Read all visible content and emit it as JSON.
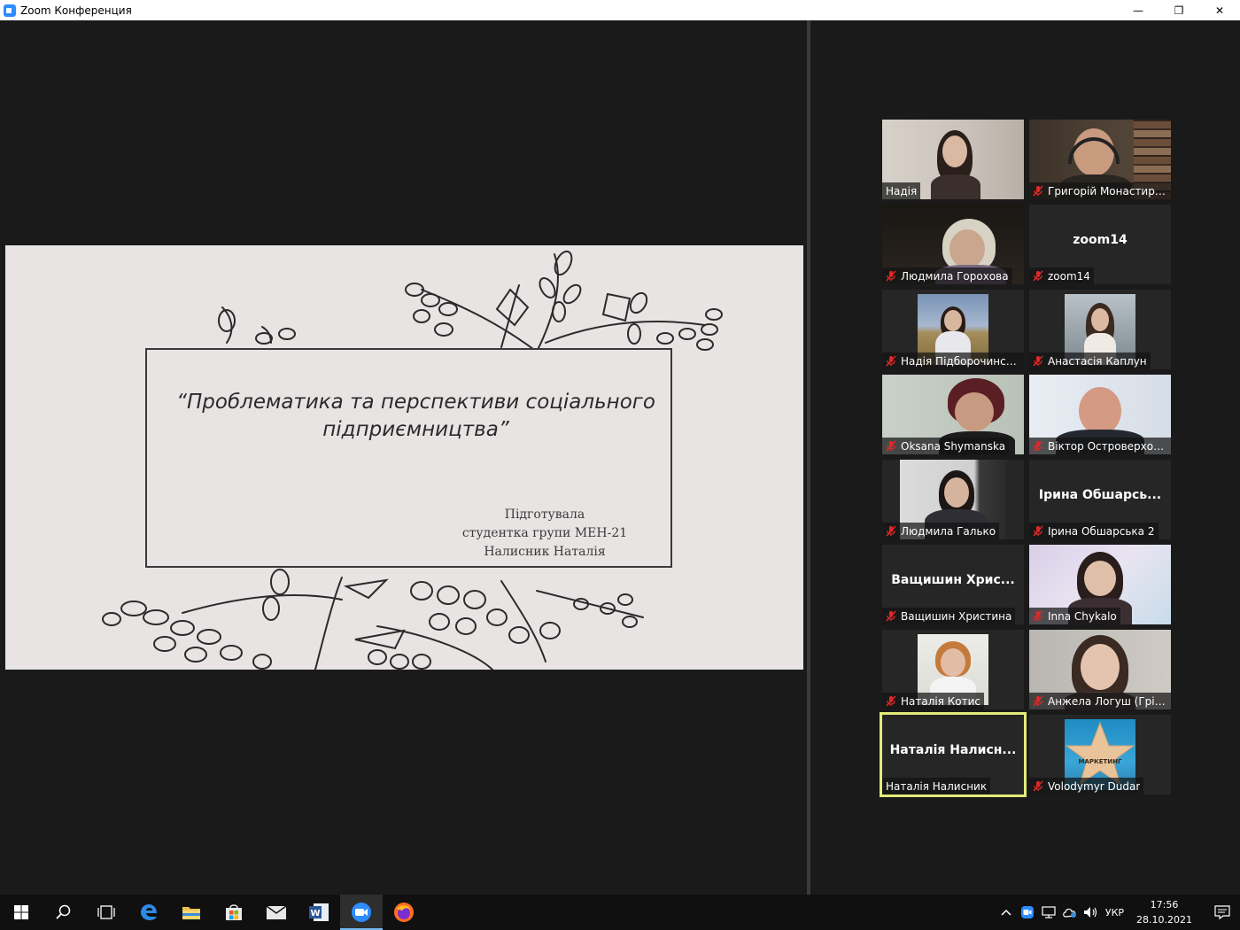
{
  "window": {
    "title": "Zoom Конференция",
    "minimize_label": "—",
    "maximize_label": "❐",
    "close_label": "✕"
  },
  "slide": {
    "title": "“Проблематика та перспективи соціального підприємництва”",
    "author_lines": [
      "Підготувала",
      "студентка групи МЕН-21",
      "Налисник Наталія"
    ]
  },
  "participants": [
    {
      "name": "Надія",
      "muted": false,
      "video": true
    },
    {
      "name": "Григорій Монастирс...",
      "muted": true,
      "video": true
    },
    {
      "name": "Людмила Горохова",
      "muted": true,
      "video": true
    },
    {
      "name": "zoom14",
      "muted": true,
      "video": false,
      "display": "zoom14"
    },
    {
      "name": "Надія Підборочинська",
      "muted": true,
      "video": true
    },
    {
      "name": "Анастасія Каплун",
      "muted": true,
      "video": true
    },
    {
      "name": "Oksana Shymanska",
      "muted": true,
      "video": true
    },
    {
      "name": "Віктор Островерхов ...",
      "muted": true,
      "video": true
    },
    {
      "name": "Людмила Галько",
      "muted": true,
      "video": true
    },
    {
      "name": "Ірина Обшарська 2",
      "muted": true,
      "video": false,
      "display": "Ірина  Обшарсь..."
    },
    {
      "name": "Ващишин Христина",
      "muted": true,
      "video": false,
      "display": "Ващишин  Хрис..."
    },
    {
      "name": "Inna Chykalo",
      "muted": true,
      "video": true
    },
    {
      "name": "Наталія Котис",
      "muted": true,
      "video": true
    },
    {
      "name": "Анжела Логуш (Гріщ...",
      "muted": true,
      "video": true
    },
    {
      "name": "Наталія Налисник",
      "muted": false,
      "video": false,
      "display": "Наталія  Налисн...",
      "active": true
    },
    {
      "name": "Volodymyr Dudar",
      "muted": true,
      "video": true
    }
  ],
  "tile_thumb_text": "МАРКЕТИНГ",
  "taskbar": {
    "apps": [
      "start-icon",
      "search-icon",
      "task-view-icon",
      "edge-icon",
      "file-explorer-icon",
      "store-icon",
      "mail-icon",
      "word-icon",
      "zoom-icon",
      "firefox-icon"
    ],
    "active_app": "zoom-icon",
    "language": "УКР",
    "time": "17:56",
    "date": "28.10.2021"
  }
}
